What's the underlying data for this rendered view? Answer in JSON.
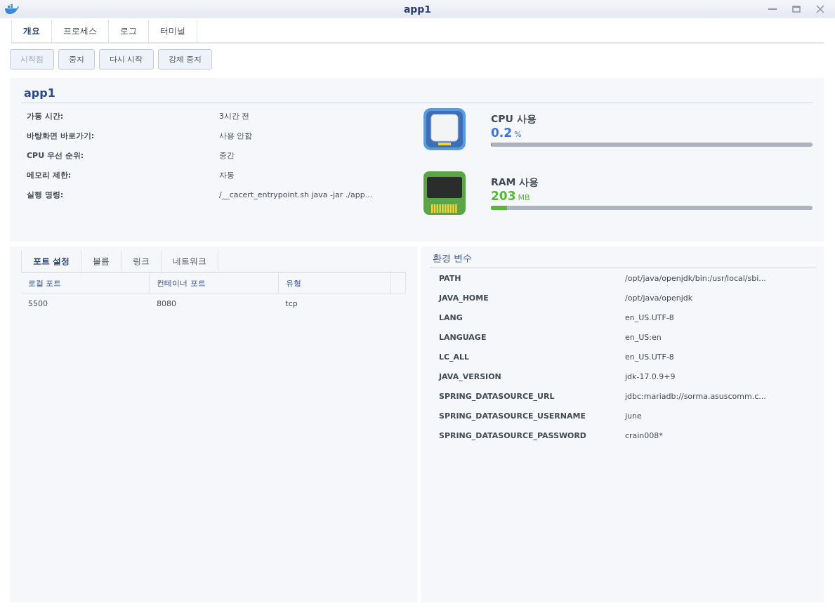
{
  "window": {
    "title": "app1"
  },
  "tabs": [
    {
      "label": "개요",
      "selected": true
    },
    {
      "label": "프로세스",
      "selected": false
    },
    {
      "label": "로그",
      "selected": false
    },
    {
      "label": "터미널",
      "selected": false
    }
  ],
  "actions": [
    {
      "label": "시작점",
      "disabled": true
    },
    {
      "label": "중지",
      "disabled": false
    },
    {
      "label": "다시 시작",
      "disabled": false
    },
    {
      "label": "강제 중지",
      "disabled": false
    }
  ],
  "overview": {
    "title": "app1",
    "fields": [
      {
        "label": "가동 시간:",
        "value": "3시간 전"
      },
      {
        "label": "바탕화면 바로가기:",
        "value": "사용 안함"
      },
      {
        "label": "CPU 우선 순위:",
        "value": "중간"
      },
      {
        "label": "메모리 제한:",
        "value": "자동"
      },
      {
        "label": "실행 명령:",
        "value": "/__cacert_entrypoint.sh java -jar ./app..."
      }
    ],
    "meters": [
      {
        "kind": "cpu",
        "label": "CPU 사용",
        "value": "0.2",
        "unit": "%",
        "level": 0.002
      },
      {
        "kind": "ram",
        "label": "RAM 사용",
        "value": "203",
        "unit": "MB",
        "level": 0.05
      }
    ]
  },
  "ports": {
    "tabs": [
      {
        "label": "포트 설정",
        "selected": true
      },
      {
        "label": "볼륨",
        "selected": false
      },
      {
        "label": "링크",
        "selected": false
      },
      {
        "label": "네트워크",
        "selected": false
      }
    ],
    "columns": [
      "로컬 포트",
      "컨테이너 포트",
      "유형"
    ],
    "rows": [
      [
        "5500",
        "8080",
        "tcp"
      ]
    ]
  },
  "environment": {
    "title": "환경 변수",
    "rows": [
      {
        "name": "PATH",
        "value": "/opt/java/openjdk/bin:/usr/local/sbi..."
      },
      {
        "name": "JAVA_HOME",
        "value": "/opt/java/openjdk"
      },
      {
        "name": "LANG",
        "value": "en_US.UTF-8"
      },
      {
        "name": "LANGUAGE",
        "value": "en_US:en"
      },
      {
        "name": "LC_ALL",
        "value": "en_US.UTF-8"
      },
      {
        "name": "JAVA_VERSION",
        "value": "jdk-17.0.9+9"
      },
      {
        "name": "SPRING_DATASOURCE_URL",
        "value": "jdbc:mariadb://sorma.asuscomm.c..."
      },
      {
        "name": "SPRING_DATASOURCE_USERNAME",
        "value": "june"
      },
      {
        "name": "SPRING_DATASOURCE_PASSWORD",
        "value": "crain008*"
      }
    ]
  }
}
